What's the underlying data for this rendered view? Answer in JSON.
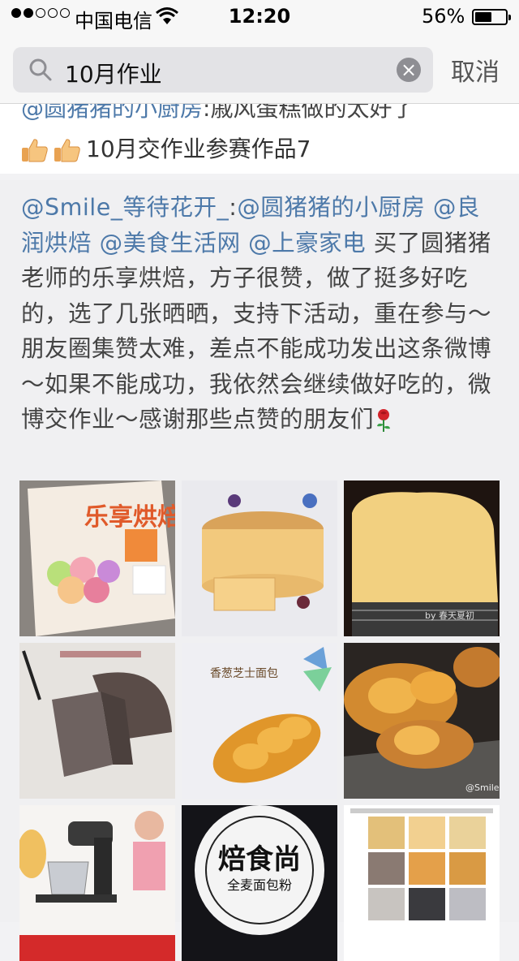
{
  "status_bar": {
    "carrier": "中国电信",
    "time": "12:20",
    "battery": "56%",
    "battery_level": 0.56,
    "signal_bars_filled": 2,
    "signal_bars_total": 5
  },
  "search": {
    "query": "10月作业",
    "cancel_label": "取消"
  },
  "posts": [
    {
      "partial_line": "@圆猪猪的小厨房:戚风蛋糕做的太好了",
      "partial_mention": "@圆猪猪的小厨房",
      "partial_rest": ":戚风蛋糕做的太好了",
      "tail_text": "10月交作业参赛作品7",
      "emoji": [
        "thumbs-up-icon",
        "thumbs-up-icon"
      ]
    },
    {
      "author_mention": "@Smile_等待花开_",
      "colon": ":",
      "mentions": [
        "@圆猪猪的小厨房",
        "@良润烘焙",
        "@美食生活网",
        "@上豪家电"
      ],
      "body": "买了圆猪猪老师的乐享烘焙，方子很赞，做了挺多好吃的，选了几张晒晒，支持下活动，重在参与～朋友圈集赞太难，差点不能成功发出这条微博～如果不能成功，我依然会继续做好吃的，微博交作业～感谢那些点赞的朋友们",
      "end_emoji": "rose-icon",
      "images": [
        {
          "name": "cookbook-cover-photo",
          "title": "乐享烘焙"
        },
        {
          "name": "chiffon-cake-page-photo",
          "title": ""
        },
        {
          "name": "bread-closeup-photo",
          "caption": "by 春天夏初"
        },
        {
          "name": "black-cocoa-chiffon-photo",
          "title": ""
        },
        {
          "name": "cheese-bread-page-photo",
          "title": "香葱芝士面包"
        },
        {
          "name": "braided-bread-photo",
          "caption": "@Smile"
        },
        {
          "name": "stand-mixer-ad-photo",
          "title": ""
        },
        {
          "name": "bread-flour-logo-photo",
          "title": "焙食尚",
          "subtitle": "全麦面包粉"
        },
        {
          "name": "weibo-screenshot-collage",
          "title": ""
        }
      ]
    }
  ],
  "colors": {
    "link": "#4d79a9",
    "text": "#444444",
    "search_field": "#e3e3e6",
    "background": "#f0f0f2"
  }
}
